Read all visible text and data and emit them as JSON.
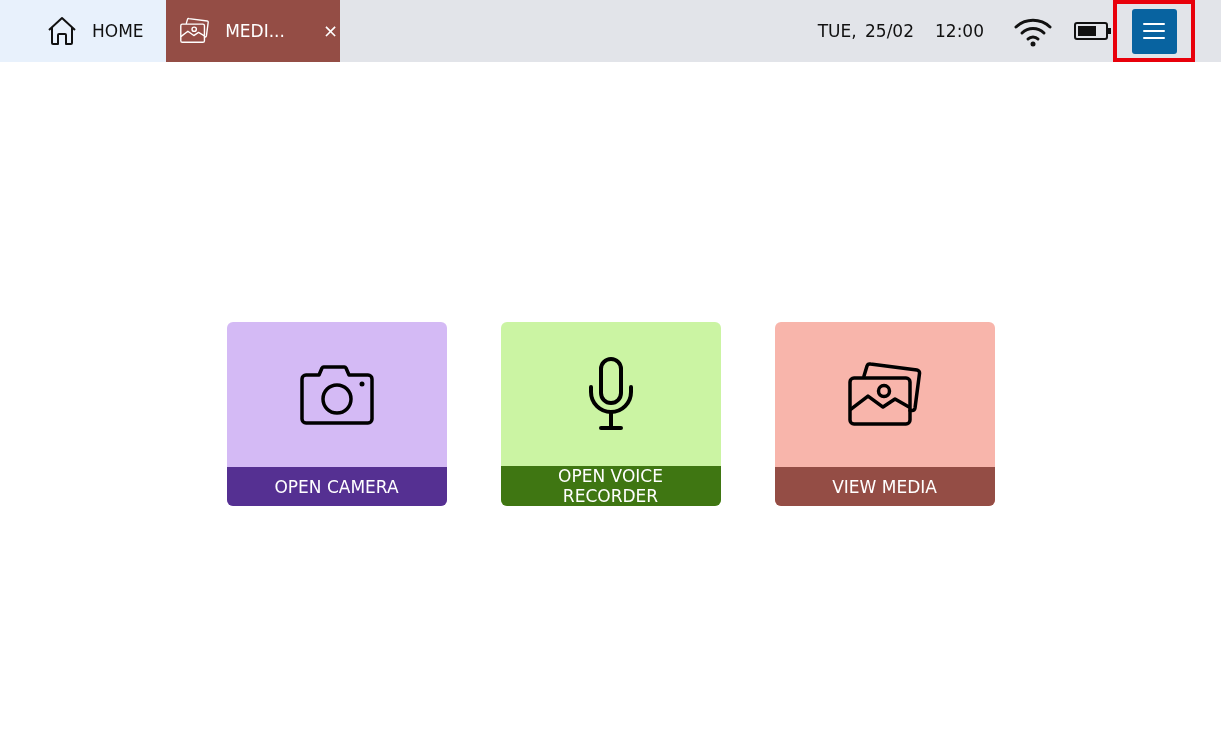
{
  "tabs": [
    {
      "kind": "home",
      "label": "HOME",
      "selected": false,
      "closable": false
    },
    {
      "kind": "media",
      "label": "MEDI...",
      "selected": true,
      "closable": true,
      "close_glyph": "×"
    }
  ],
  "status": {
    "date": "TUE, 25/02",
    "time": "12:00"
  },
  "menu_button": {
    "highlighted": true
  },
  "tiles": [
    {
      "kind": "camera",
      "label": "OPEN CAMERA",
      "color": "#d4baf5",
      "band": {
        "color": "#553092"
      }
    },
    {
      "kind": "microphone",
      "label": "OPEN VOICE RECORDER",
      "color": "#cbf4a3",
      "band": {
        "color": "#3f7612"
      }
    },
    {
      "kind": "media",
      "label": "VIEW MEDIA",
      "color": "#f8b5ab",
      "band": {
        "color": "#944d45"
      }
    }
  ]
}
